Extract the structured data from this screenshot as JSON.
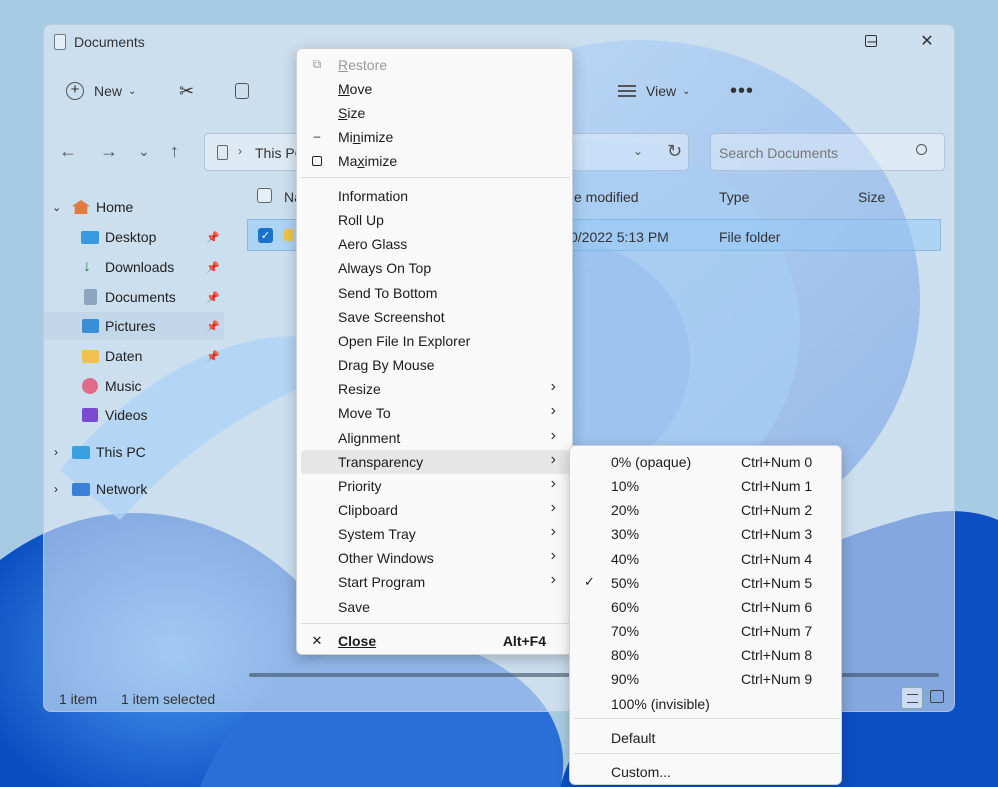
{
  "explorer": {
    "title": "Documents",
    "toolbar": {
      "new_label": "New",
      "view_label": "View"
    },
    "address": {
      "path_root": "This PC",
      "search_placeholder": "Search Documents"
    },
    "sidebar": {
      "home": "Home",
      "items": [
        {
          "label": "Desktop",
          "pinned": true
        },
        {
          "label": "Downloads",
          "pinned": true
        },
        {
          "label": "Documents",
          "pinned": true
        },
        {
          "label": "Pictures",
          "pinned": true
        },
        {
          "label": "Daten",
          "pinned": true
        },
        {
          "label": "Music",
          "pinned": false
        },
        {
          "label": "Videos",
          "pinned": false
        }
      ],
      "this_pc": "This PC",
      "network": "Network"
    },
    "columns": {
      "name": "Na",
      "date_modified": "e modified",
      "type": "Type",
      "size": "Size"
    },
    "row": {
      "date": "0/2022 5:13 PM",
      "type": "File folder"
    },
    "status": {
      "count": "1 item",
      "selected": "1 item selected"
    }
  },
  "menu": {
    "restore": "Restore",
    "move": "Move",
    "size": "Size",
    "minimize": "Minimize",
    "maximize": "Maximize",
    "items": [
      {
        "label": "Information",
        "submenu": false
      },
      {
        "label": "Roll Up",
        "submenu": false
      },
      {
        "label": "Aero Glass",
        "submenu": false
      },
      {
        "label": "Always On Top",
        "submenu": false
      },
      {
        "label": "Send To Bottom",
        "submenu": false
      },
      {
        "label": "Save Screenshot",
        "submenu": false
      },
      {
        "label": "Open File In Explorer",
        "submenu": false
      },
      {
        "label": "Drag By Mouse",
        "submenu": false
      },
      {
        "label": "Resize",
        "submenu": true
      },
      {
        "label": "Move To",
        "submenu": true
      },
      {
        "label": "Alignment",
        "submenu": true
      },
      {
        "label": "Transparency",
        "submenu": true
      },
      {
        "label": "Priority",
        "submenu": true
      },
      {
        "label": "Clipboard",
        "submenu": true
      },
      {
        "label": "System Tray",
        "submenu": true
      },
      {
        "label": "Other Windows",
        "submenu": true
      },
      {
        "label": "Start Program",
        "submenu": true
      },
      {
        "label": "Save",
        "submenu": false
      }
    ],
    "close": "Close",
    "close_shortcut": "Alt+F4"
  },
  "transparency_submenu": {
    "items": [
      {
        "label": "0% (opaque)",
        "shortcut": "Ctrl+Num 0",
        "checked": false
      },
      {
        "label": "10%",
        "shortcut": "Ctrl+Num 1",
        "checked": false
      },
      {
        "label": "20%",
        "shortcut": "Ctrl+Num 2",
        "checked": false
      },
      {
        "label": "30%",
        "shortcut": "Ctrl+Num 3",
        "checked": false
      },
      {
        "label": "40%",
        "shortcut": "Ctrl+Num 4",
        "checked": false
      },
      {
        "label": "50%",
        "shortcut": "Ctrl+Num 5",
        "checked": true
      },
      {
        "label": "60%",
        "shortcut": "Ctrl+Num 6",
        "checked": false
      },
      {
        "label": "70%",
        "shortcut": "Ctrl+Num 7",
        "checked": false
      },
      {
        "label": "80%",
        "shortcut": "Ctrl+Num 8",
        "checked": false
      },
      {
        "label": "90%",
        "shortcut": "Ctrl+Num 9",
        "checked": false
      },
      {
        "label": "100% (invisible)",
        "shortcut": "",
        "checked": false
      }
    ],
    "default": "Default",
    "custom": "Custom..."
  },
  "colors": {
    "accent": "#1a73c9",
    "wallpaper_blue": "#1e6fd9",
    "menu_bg": "#f9f9f9",
    "highlight": "#e6e6e6"
  }
}
